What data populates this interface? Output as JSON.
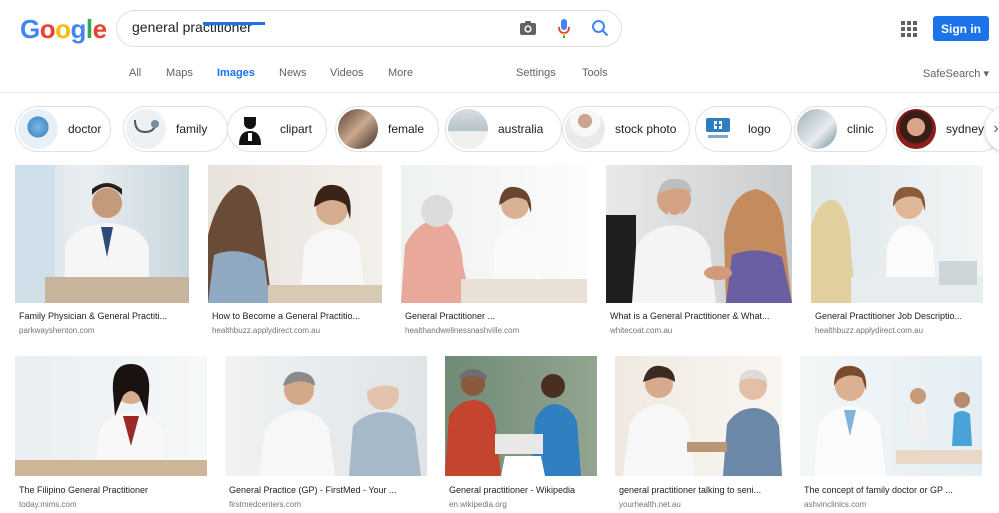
{
  "logo": {
    "letters": [
      "G",
      "o",
      "o",
      "g",
      "l",
      "e"
    ],
    "colors": [
      "#4285F4",
      "#EA4335",
      "#FBBC05",
      "#4285F4",
      "#34A853",
      "#EA4335"
    ]
  },
  "search": {
    "value": "general practitioner",
    "placeholder": ""
  },
  "header": {
    "signin_label": "Sign in",
    "accent": "#1a73e8"
  },
  "nav": {
    "tabs": [
      "All",
      "Maps",
      "Images",
      "News",
      "Videos",
      "More"
    ],
    "active": "Images",
    "settings": "Settings",
    "tools": "Tools",
    "safesearch": "SafeSearch"
  },
  "chips": [
    {
      "label": "doctor",
      "icon": "doctor-thumb"
    },
    {
      "label": "family",
      "icon": "stethoscope-thumb"
    },
    {
      "label": "clipart",
      "icon": "clipart-thumb"
    },
    {
      "label": "female",
      "icon": "female-thumb"
    },
    {
      "label": "australia",
      "icon": "australia-thumb"
    },
    {
      "label": "stock photo",
      "icon": "stock-photo-thumb"
    },
    {
      "label": "logo",
      "icon": "logo-thumb"
    },
    {
      "label": "clinic",
      "icon": "clinic-thumb"
    },
    {
      "label": "sydney",
      "icon": "sydney-thumb"
    }
  ],
  "results": [
    {
      "title": "Family Physician & General Practiti...",
      "source": "parkwayshenton.com"
    },
    {
      "title": "How to Become a General Practitio...",
      "source": "healthbuzz.applydirect.com.au"
    },
    {
      "title": "General Practitioner ...",
      "source": "healthandwellnessnashville.com"
    },
    {
      "title": "What is a General Practitioner & What...",
      "source": "whitecoat.com.au"
    },
    {
      "title": "General Practitioner Job Descriptio...",
      "source": "healthbuzz.applydirect.com.au"
    },
    {
      "title": "The Filipino General Practitioner",
      "source": "today.mims.com"
    },
    {
      "title": "General Practice (GP) - FirstMed - Your ...",
      "source": "firstmedcenters.com"
    },
    {
      "title": "General practitioner - Wikipedia",
      "source": "en.wikipedia.org"
    },
    {
      "title": "general practitioner talking to seni...",
      "source": "yourhealth.net.au"
    },
    {
      "title": "The concept of family doctor or GP ...",
      "source": "ashvinclinics.com"
    }
  ]
}
